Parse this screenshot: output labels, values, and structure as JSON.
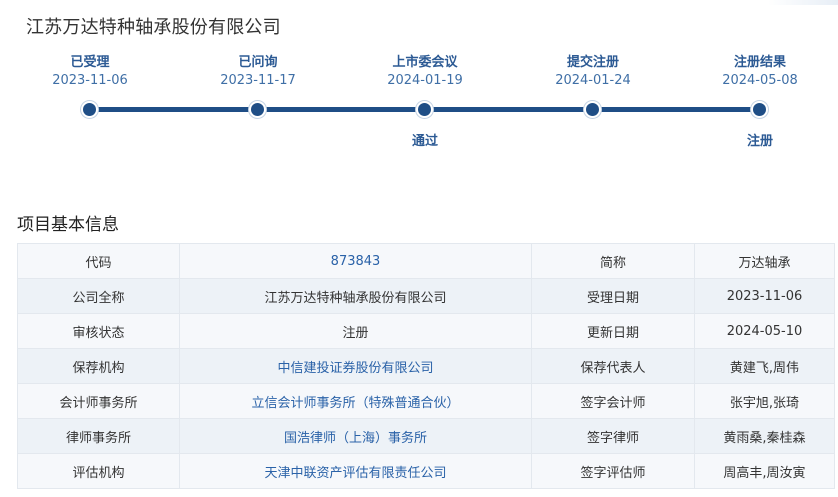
{
  "company_title": "江苏万达特种轴承股份有限公司",
  "timeline": {
    "steps": [
      {
        "label": "已受理",
        "date": "2023-11-06",
        "result": ""
      },
      {
        "label": "已问询",
        "date": "2023-11-17",
        "result": ""
      },
      {
        "label": "上市委会议",
        "date": "2024-01-19",
        "result": "通过"
      },
      {
        "label": "提交注册",
        "date": "2024-01-24",
        "result": ""
      },
      {
        "label": "注册结果",
        "date": "2024-05-08",
        "result": "注册"
      }
    ]
  },
  "section_title": "项目基本信息",
  "table": {
    "rows": [
      {
        "k1": "代码",
        "v1": "873843",
        "k2": "简称",
        "v2": "万达轴承"
      },
      {
        "k1": "公司全称",
        "v1": "江苏万达特种轴承股份有限公司",
        "k2": "受理日期",
        "v2": "2023-11-06"
      },
      {
        "k1": "审核状态",
        "v1": "注册",
        "k2": "更新日期",
        "v2": "2024-05-10"
      },
      {
        "k1": "保荐机构",
        "v1": "中信建投证券股份有限公司",
        "k2": "保荐代表人",
        "v2": "黄建飞,周伟"
      },
      {
        "k1": "会计师事务所",
        "v1": "立信会计师事务所（特殊普通合伙）",
        "k2": "签字会计师",
        "v2": "张宇旭,张琦"
      },
      {
        "k1": "律师事务所",
        "v1": "国浩律师（上海）事务所",
        "k2": "签字律师",
        "v2": "黄雨桑,秦桂森"
      },
      {
        "k1": "评估机构",
        "v1": "天津中联资产评估有限责任公司",
        "k2": "签字评估师",
        "v2": "周高丰,周汝寅"
      }
    ]
  },
  "colors": {
    "accent": "#1f4e86",
    "link": "#2a62a8"
  }
}
